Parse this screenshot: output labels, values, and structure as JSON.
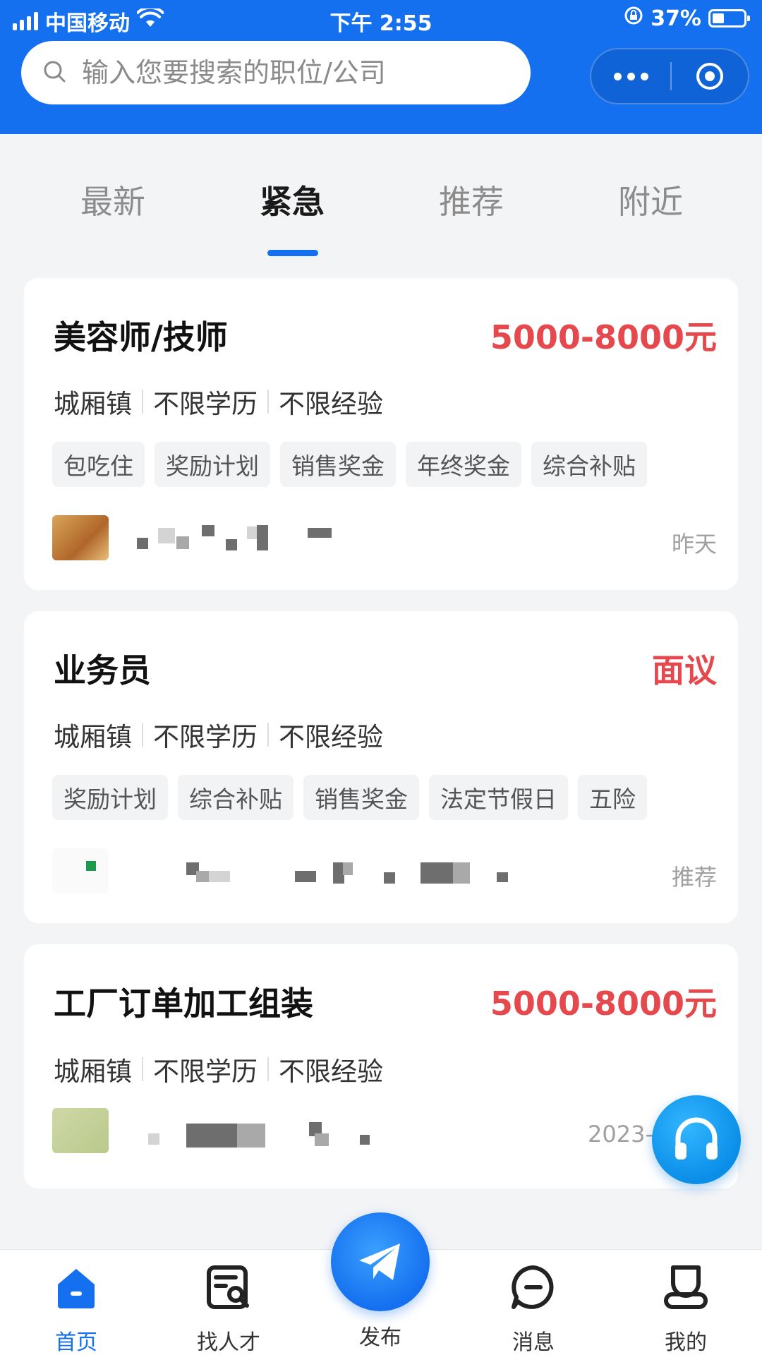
{
  "status_bar": {
    "carrier": "中国移动",
    "time": "下午 2:55",
    "battery": "37%",
    "battery_level": 0.37
  },
  "search": {
    "placeholder": "输入您要搜索的职位/公司"
  },
  "tabs": [
    {
      "label": "最新",
      "active": false
    },
    {
      "label": "紧急",
      "active": true
    },
    {
      "label": "推荐",
      "active": false
    },
    {
      "label": "附近",
      "active": false
    }
  ],
  "jobs": [
    {
      "title": "美容师/技师",
      "salary": "5000-8000元",
      "location": "城厢镇",
      "education": "不限学历",
      "experience": "不限经验",
      "tags": [
        "包吃住",
        "奖励计划",
        "销售奖金",
        "年终奖金",
        "综合补贴"
      ],
      "time": "昨天"
    },
    {
      "title": "业务员",
      "salary": "面议",
      "location": "城厢镇",
      "education": "不限学历",
      "experience": "不限经验",
      "tags": [
        "奖励计划",
        "综合补贴",
        "销售奖金",
        "法定节假日",
        "五险"
      ],
      "time": "推荐"
    },
    {
      "title": "工厂订单加工组装",
      "salary": "5000-8000元",
      "location": "城厢镇",
      "education": "不限学历",
      "experience": "不限经验",
      "tags": [],
      "time": "2023-"
    }
  ],
  "bottom_nav": [
    {
      "label": "首页",
      "icon": "home-icon",
      "active": true
    },
    {
      "label": "找人才",
      "icon": "find-talent-icon",
      "active": false
    },
    {
      "label": "发布",
      "icon": "paper-plane-icon",
      "active": false
    },
    {
      "label": "消息",
      "icon": "message-icon",
      "active": false
    },
    {
      "label": "我的",
      "icon": "profile-icon",
      "active": false
    }
  ],
  "colors": {
    "primary": "#1570ef",
    "salary": "#e5484d",
    "background": "#f3f4f6"
  }
}
